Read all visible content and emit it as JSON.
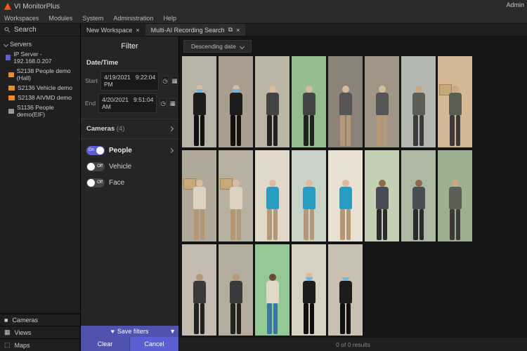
{
  "app": {
    "title": "VI MonitorPlus",
    "admin_label": "Admin"
  },
  "menu": {
    "workspaces": "Workspaces",
    "modules": "Modules",
    "system": "System",
    "administration": "Administration",
    "help": "Help"
  },
  "sidebar": {
    "search": "Search",
    "servers_label": "Servers",
    "server_name": "IP Server - 192.168.0.207",
    "items": [
      {
        "label": "S2138 People demo (Hall)"
      },
      {
        "label": "S2136 Vehicle demo"
      },
      {
        "label": "S2138 AIVMD demo"
      },
      {
        "label": "S1136 People demo(EIF)"
      }
    ],
    "nav": {
      "cameras": "Cameras",
      "views": "Views",
      "maps": "Maps"
    }
  },
  "tabs": {
    "new_workspace": "New Workspace",
    "multi_ai": "Multi-AI Recording Search"
  },
  "filter": {
    "title": "Filter",
    "datetime_label": "Date/Time",
    "start_label": "Start",
    "start_date": "4/19/2021",
    "start_time": "9:22:04 PM",
    "end_label": "End",
    "end_date": "4/20/2021",
    "end_time": "9:51:04 AM",
    "cameras_label": "Cameras",
    "cameras_count": "(4)",
    "people_label": "People",
    "vehicle_label": "Vehicle",
    "face_label": "Face",
    "on_text": "On",
    "off_text": "Off",
    "save_filters": "Save filters",
    "clear": "Clear",
    "cancel": "Cancel"
  },
  "results": {
    "sort": "Descending date",
    "status": "0 of 0 results"
  },
  "people": [
    [
      {
        "bg": "#b7b2a8",
        "head": "#d8bca0",
        "torso": "#1c1c1c",
        "legs": "#111",
        "mask": "#6db8e0"
      },
      {
        "bg": "#a89f90",
        "head": "#d8bca0",
        "torso": "#1c1c1c",
        "legs": "#111",
        "mask": "#6db8e0"
      },
      {
        "bg": "#bcb4a5",
        "head": "#d8bca0",
        "torso": "#444",
        "legs": "#222"
      },
      {
        "bg": "#94bc8f",
        "head": "#d8bca0",
        "torso": "#444",
        "legs": "#222"
      },
      {
        "bg": "#8b8378",
        "head": "#d8bca0",
        "torso": "#555",
        "legs": "#b39878"
      },
      {
        "bg": "#a09688",
        "head": "#d8bca0",
        "torso": "#555",
        "legs": "#b39878"
      },
      {
        "bg": "#b2b8b0",
        "head": "#c9a887",
        "torso": "#5a5e54",
        "legs": "#3a3a3a"
      },
      {
        "bg": "#d4b895",
        "head": "#c9a887",
        "torso": "#5a5e54",
        "legs": "#3a3a3a",
        "box": "#c9a878"
      }
    ],
    [
      {
        "bg": "#b0a898",
        "head": "#d8bca0",
        "torso": "#dcd2c0",
        "legs": "#b39878",
        "box": "#c9a878"
      },
      {
        "bg": "#b8b0a0",
        "head": "#d8bca0",
        "torso": "#dcd2c0",
        "legs": "#b39878",
        "box": "#c9a878"
      },
      {
        "bg": "#e0d8c8",
        "head": "#d8bca0",
        "torso": "#2a9cc4",
        "legs": "#b39878"
      },
      {
        "bg": "#c8d4c8",
        "head": "#d8bca0",
        "torso": "#2a9cc4",
        "legs": "#b39878"
      },
      {
        "bg": "#e8e0d0",
        "head": "#d8bca0",
        "torso": "#2a9cc4",
        "legs": "#b39878"
      },
      {
        "bg": "#c4d0b4",
        "head": "#8a6850",
        "torso": "#4a4e54",
        "legs": "#2a2a2a"
      },
      {
        "bg": "#aab8a4",
        "head": "#8a6850",
        "torso": "#4a4e54",
        "legs": "#2a2a2a"
      },
      {
        "bg": "#9cb090",
        "head": "#c9a887",
        "torso": "#5a5e54",
        "legs": "#3a3a3a"
      }
    ],
    [
      {
        "bg": "#c4bcb0",
        "head": "#b89878",
        "torso": "#3a3a3a",
        "legs": "#222"
      },
      {
        "bg": "#b4ac9c",
        "head": "#b89878",
        "torso": "#3a3a3a",
        "legs": "#222"
      },
      {
        "bg": "#94c894",
        "head": "#6a4a38",
        "torso": "#e0d8c8",
        "legs": "#3878a0"
      },
      {
        "bg": "#d8d0c0",
        "head": "#d8bca0",
        "torso": "#1c1c1c",
        "legs": "#111",
        "mask": "#6db8e0"
      },
      {
        "bg": "#c8c0b0",
        "head": "#d8bca0",
        "torso": "#1c1c1c",
        "legs": "#111",
        "mask": "#6db8e0"
      }
    ]
  ]
}
